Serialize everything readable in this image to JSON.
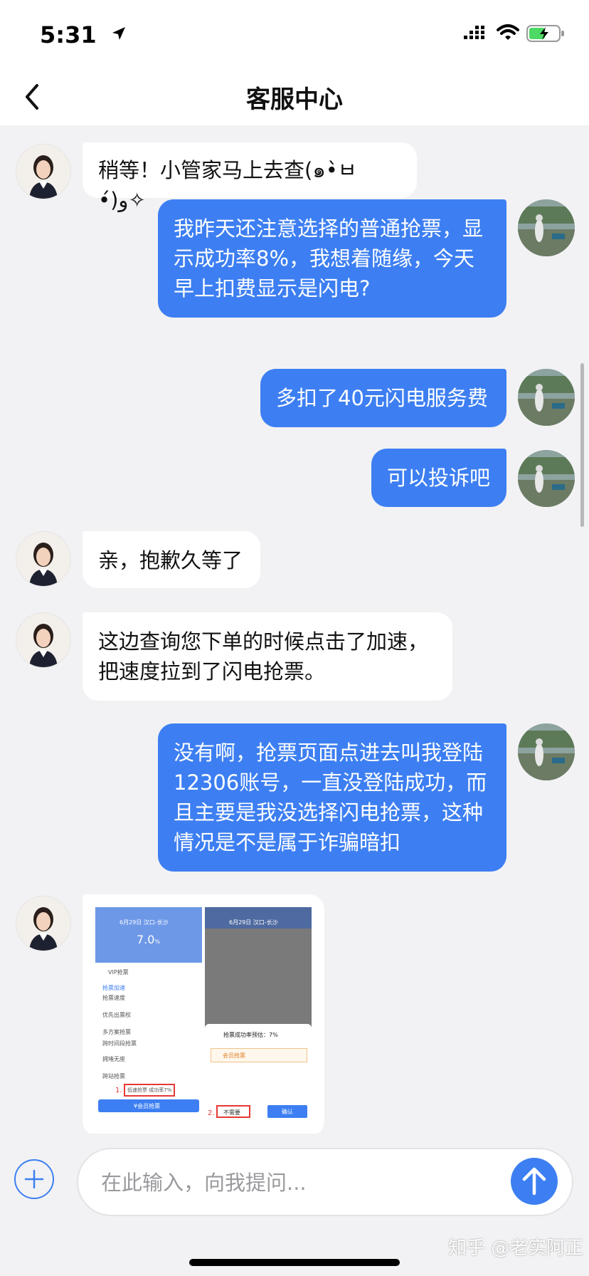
{
  "status_bar": {
    "time": "5:31"
  },
  "nav": {
    "title": "客服中心"
  },
  "messages": [
    {
      "from": "agent",
      "text": "稍等！小管家马上去查(๑•̀ㅂ•́)و✧"
    },
    {
      "from": "user",
      "text": "我昨天还注意选择的普通抢票，显\n示成功率8%，我想着随缘，今天\n早上扣费显示是闪电?"
    },
    {
      "from": "user",
      "text": "多扣了40元闪电服务费"
    },
    {
      "from": "user",
      "text": "可以投诉吧"
    },
    {
      "from": "agent",
      "text": "亲，抱歉久等了"
    },
    {
      "from": "agent",
      "text": "这边查询您下单的时候点击了加速，\n把速度拉到了闪电抢票。"
    },
    {
      "from": "user",
      "text": "没有啊，抢票页面点进去叫我登陆\n12306账号，一直没登陆成功，而\n且主要是我没选择闪电抢票，这种\n情况是不是属于诈骗暗扣"
    }
  ],
  "image_message": {
    "left_screen": {
      "header_title": "6月29日 汉口-长沙",
      "rate": "7.0",
      "rate_unit": "%",
      "rows": [
        "VIP抢票",
        "抢票加速",
        "抢票速度",
        "优先出票权",
        "多方案抢票",
        "跨时间段抢票",
        "拥堵无座",
        "跨站抢票"
      ],
      "step_label": "1.",
      "step_text": "低速抢票 成功率7%",
      "button": "¥会员抢票"
    },
    "right_screen": {
      "header_title": "6月29日 汉口-长沙",
      "dialog_title": "抢票成功率预估：7%",
      "dialog_badge": "会员抢票",
      "step_label": "2.",
      "btn_no": "不需要",
      "btn_yes": "确认"
    }
  },
  "input": {
    "placeholder": "在此输入，向我提问..."
  },
  "watermark": "知乎 @老实阿正",
  "colors": {
    "accent": "#3d7ff2",
    "agent_bubble": "#ffffff",
    "background": "#f2f2f4"
  }
}
